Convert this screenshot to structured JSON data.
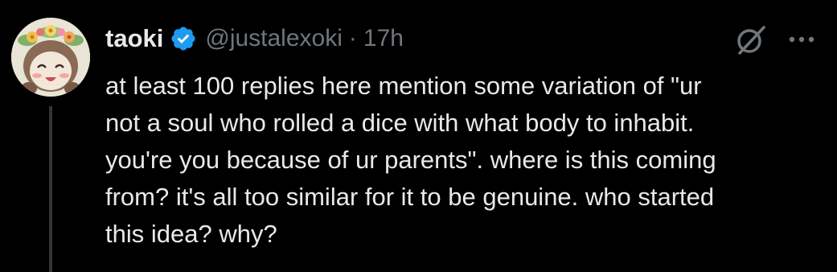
{
  "tweet": {
    "display_name": "taoki",
    "handle": "@justalexoki",
    "separator": "·",
    "timestamp": "17h",
    "body_lines": [
      "at least 100 replies here mention some variation of \"ur",
      "not a soul who rolled a dice with what body to inhabit.",
      "you're you because of ur parents\". where is this coming",
      "from? it's all too similar for it to be genuine. who started",
      "this idea? why?"
    ]
  },
  "icons": {
    "verified": "verified-badge-icon",
    "grok": "grok-icon",
    "more": "more-options-icon"
  },
  "colors": {
    "background": "#000000",
    "primary_text": "#e7e9ea",
    "secondary_text": "#71767b",
    "verified_blue": "#1d9bf0",
    "thread_line": "#333639"
  }
}
